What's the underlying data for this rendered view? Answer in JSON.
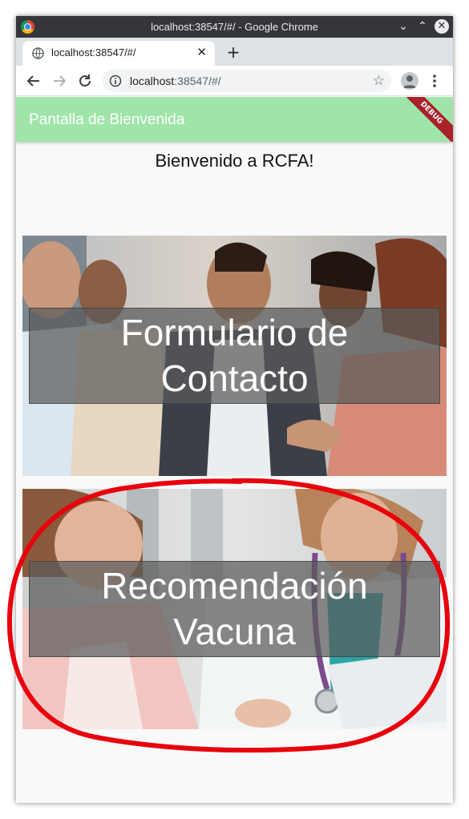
{
  "window": {
    "title": "localhost:38547/#/ - Google Chrome"
  },
  "tab": {
    "title": "localhost:38547/#/"
  },
  "address": {
    "host": "localhost",
    "rest": ":38547/#/"
  },
  "app": {
    "appbar_title": "Pantalla de Bienvenida",
    "debug_banner": "DEBUG",
    "welcome_text": "Bienvenido a RCFA!",
    "cards": [
      {
        "label": "Formulario de Contacto"
      },
      {
        "label": "Recomendación Vacuna"
      }
    ]
  },
  "colors": {
    "appbar": "#9fe4a9",
    "annotation": "#e8000c"
  }
}
